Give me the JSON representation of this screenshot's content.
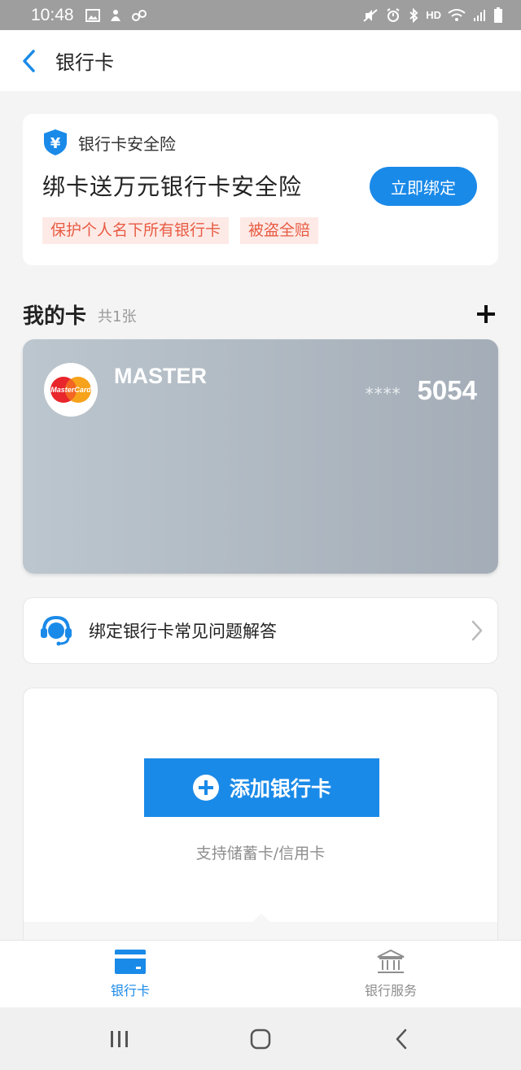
{
  "status_bar": {
    "time": "10:48",
    "left_icons": [
      "image-icon",
      "app-icon",
      "link-icon"
    ],
    "right_icons": [
      "mute-icon",
      "alarm-icon",
      "bluetooth-icon",
      "hd-voice-icon",
      "wifi-icon",
      "signal-icon",
      "battery-icon"
    ],
    "hd_label": "HD"
  },
  "header": {
    "title": "银行卡"
  },
  "promo": {
    "brand": "银行卡安全险",
    "headline": "绑卡送万元银行卡安全险",
    "button_label": "立即绑定",
    "tags": [
      "保护个人名下所有银行卡",
      "被盗全赔"
    ]
  },
  "my_cards": {
    "title": "我的卡",
    "count_text": "共1张",
    "cards": [
      {
        "brand": "MASTER",
        "logo_text": "MasterCard",
        "mask": "****",
        "last4": "5054"
      }
    ]
  },
  "faq": {
    "label": "绑定银行卡常见问题解答"
  },
  "add_card": {
    "button_label": "添加银行卡",
    "subtitle": "支持储蓄卡/信用卡"
  },
  "tab_bar": {
    "tabs": [
      {
        "label": "银行卡",
        "icon": "card-icon",
        "active": true
      },
      {
        "label": "银行服务",
        "icon": "bank-icon",
        "active": false
      }
    ]
  },
  "colors": {
    "accent": "#1a8ae8",
    "tag_bg": "#fdeae6",
    "tag_text": "#e85b43",
    "card_gradient_start": "#bcc6ce",
    "card_gradient_end": "#a4adb7"
  }
}
